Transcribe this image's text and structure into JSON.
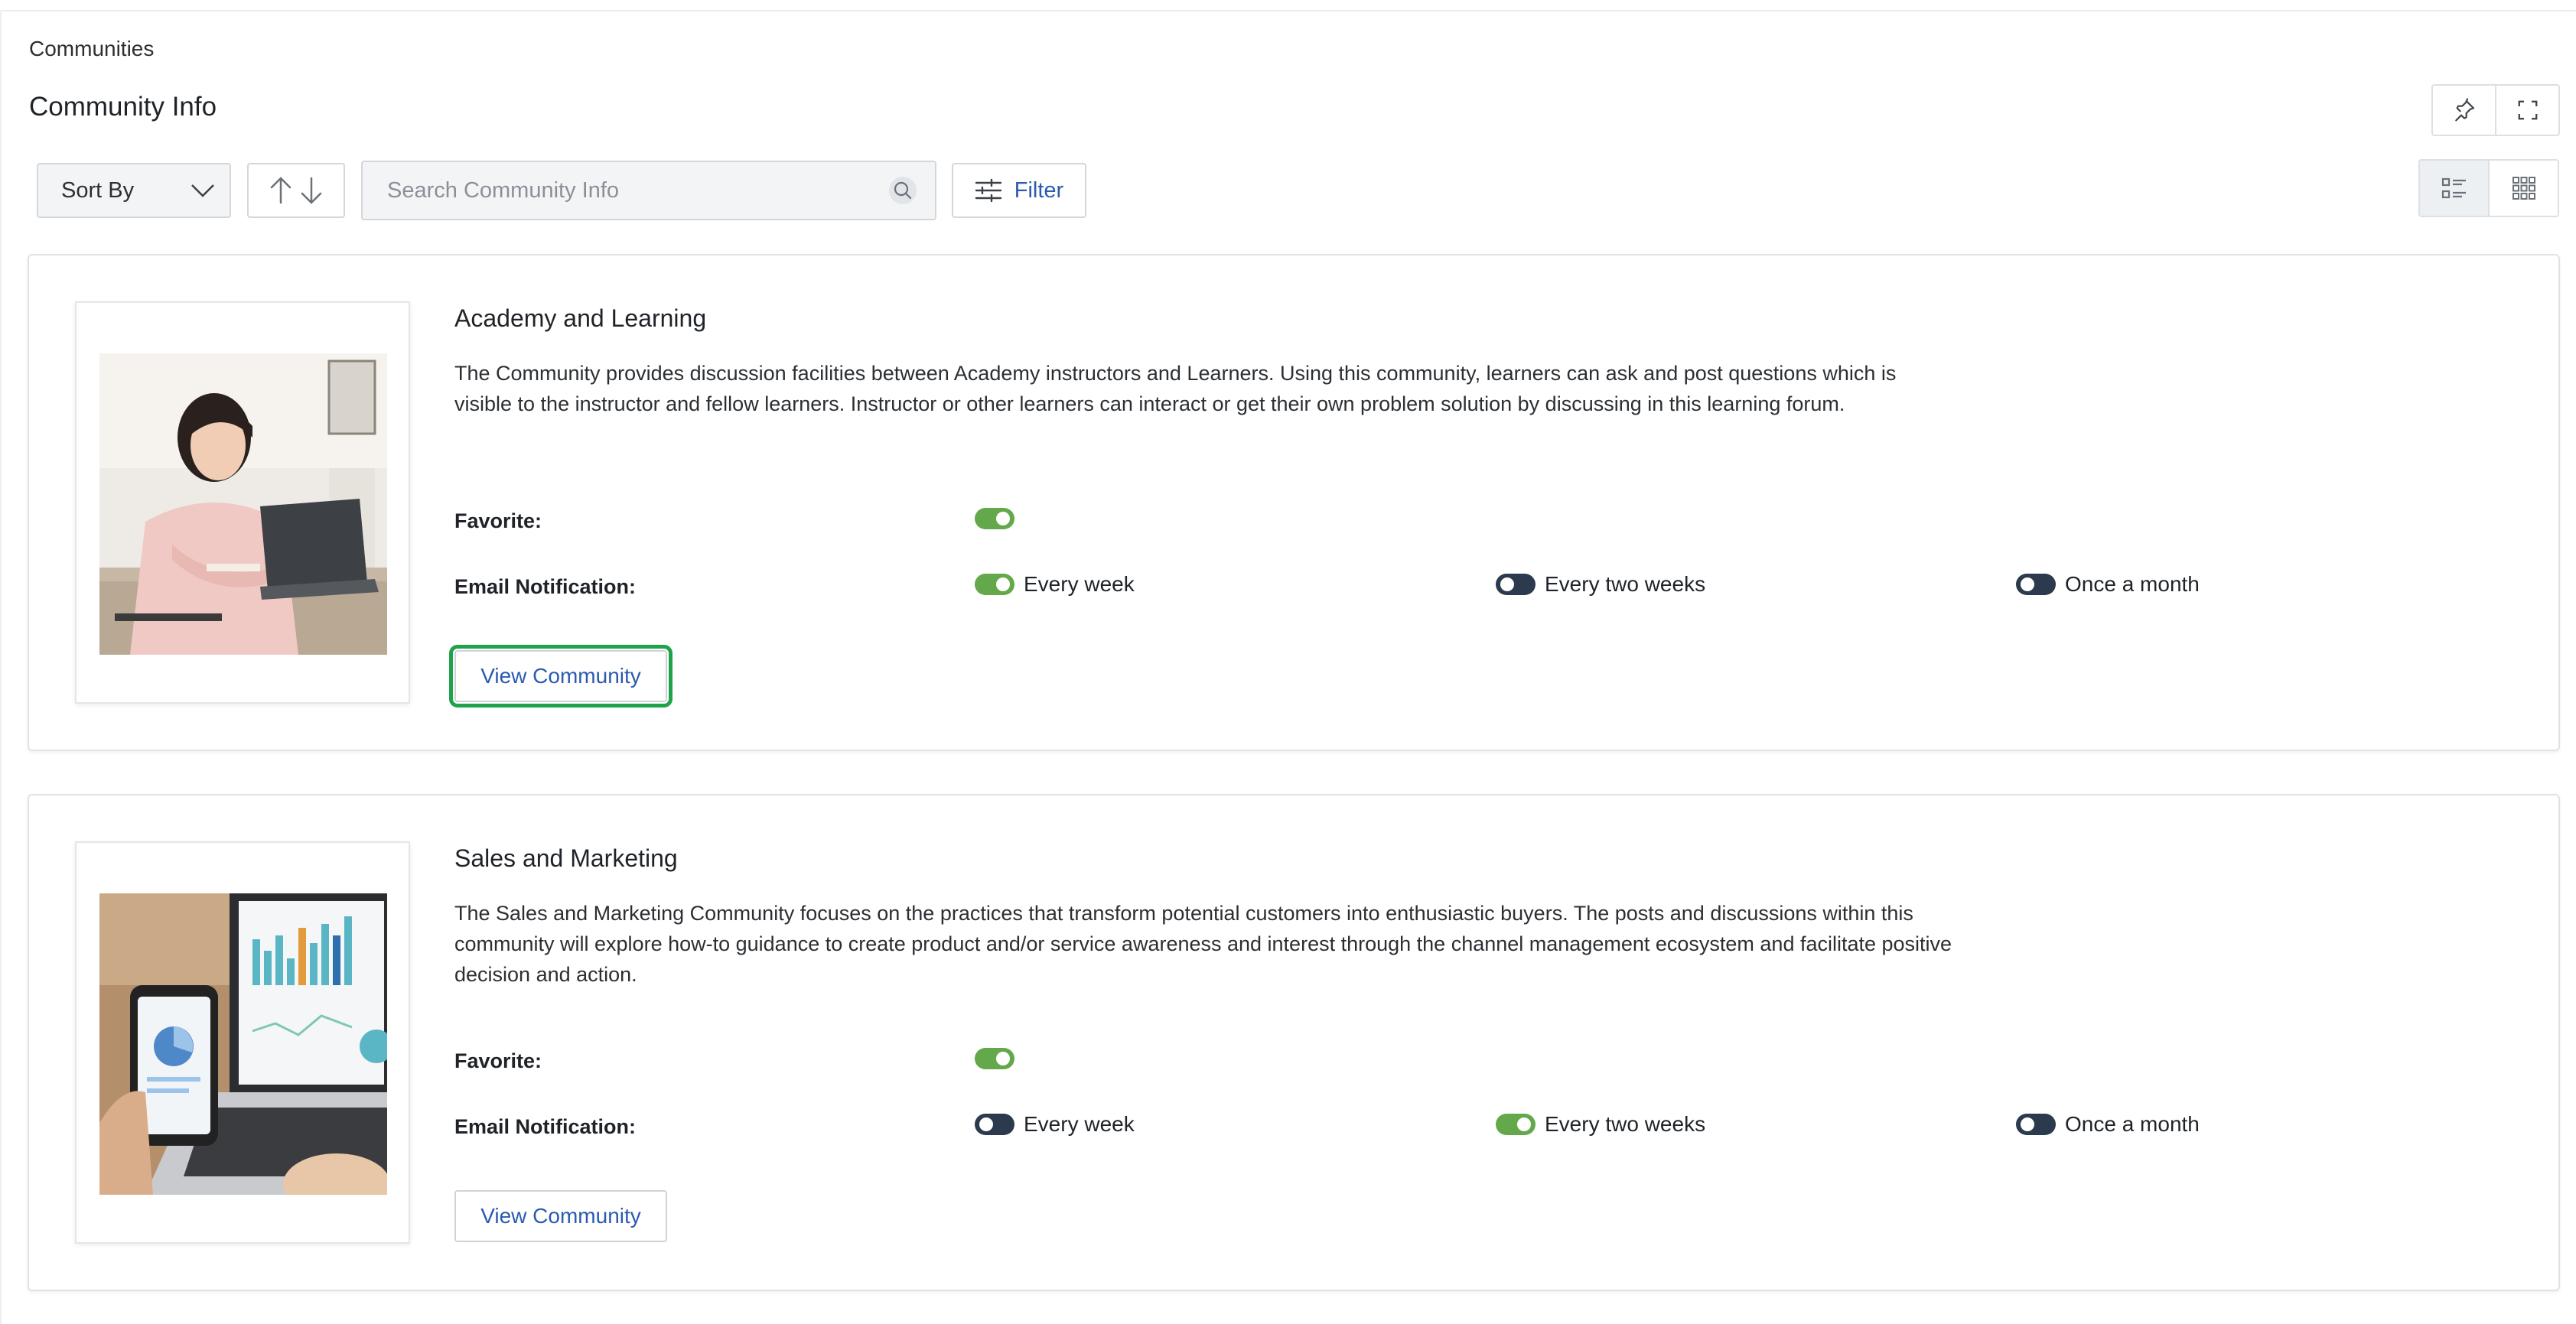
{
  "breadcrumb": "Communities",
  "page_title": "Community Info",
  "toolbar": {
    "sort_label": "Sort By",
    "search_placeholder": "Search Community Info",
    "filter_label": "Filter"
  },
  "icons": {
    "pin": "pin-icon",
    "fullscreen": "fullscreen-icon",
    "list_view": "list-view-icon",
    "grid_view": "grid-view-icon",
    "search": "search-icon",
    "filter": "filter-icon",
    "sort": "sort-arrows-icon",
    "chevron": "chevron-down-icon"
  },
  "colors": {
    "accent": "#2a5bb0",
    "toggle_on": "#63a84a",
    "toggle_off": "#2c3a4e",
    "highlight": "#1fa34a"
  },
  "communities": [
    {
      "title": "Academy and Learning",
      "description": "The Community provides discussion facilities between Academy instructors and Learners. Using this community, learners can ask and post questions which is visible to the instructor and fellow learners. Instructor or other learners can interact or get their own problem solution by discussing in this learning forum.",
      "favorite_label": "Favorite:",
      "favorite": true,
      "email_label": "Email Notification:",
      "options": [
        {
          "label": "Every week",
          "on": true
        },
        {
          "label": "Every two weeks",
          "on": false
        },
        {
          "label": "Once a month",
          "on": false
        }
      ],
      "button_label": "View Community"
    },
    {
      "title": "Sales and Marketing",
      "description": "The Sales and Marketing Community focuses on the practices that transform potential customers into enthusiastic buyers. The posts and discussions within this community will explore how-to guidance to create product and/or service awareness and interest through the channel management ecosystem and facilitate positive decision and action.",
      "favorite_label": "Favorite:",
      "favorite": true,
      "email_label": "Email Notification:",
      "options": [
        {
          "label": "Every week",
          "on": false
        },
        {
          "label": "Every two weeks",
          "on": true
        },
        {
          "label": "Once a month",
          "on": false
        }
      ],
      "button_label": "View Community"
    }
  ]
}
